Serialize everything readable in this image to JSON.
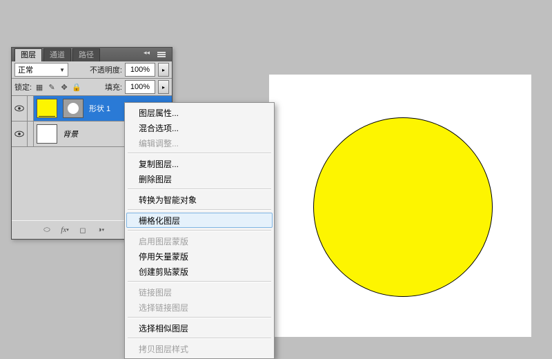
{
  "workspace": {
    "bg_color": "#bfbfbf"
  },
  "canvas": {
    "bg_color": "#ffffff",
    "shape": {
      "kind": "circle",
      "fill": "#fdf500",
      "stroke": "#000000"
    }
  },
  "panel": {
    "tabs": [
      {
        "id": "layers",
        "label": "图层",
        "active": true
      },
      {
        "id": "channels",
        "label": "通道",
        "active": false
      },
      {
        "id": "paths",
        "label": "路径",
        "active": false
      }
    ],
    "blend_mode": {
      "value": "正常"
    },
    "opacity": {
      "label": "不透明度:",
      "value": "100%"
    },
    "lock": {
      "label": "锁定:"
    },
    "fill": {
      "label": "填充:",
      "value": "100%"
    },
    "layers": [
      {
        "id": "shape1",
        "name": "形状 1",
        "visible": true,
        "selected": true,
        "thumb_color": "#fdf500",
        "has_mask": true
      },
      {
        "id": "bg",
        "name": "背景",
        "visible": true,
        "selected": false,
        "thumb_color": "#ffffff",
        "has_mask": false,
        "locked": true
      }
    ],
    "footer_icons": [
      "link",
      "fx",
      "mask",
      "adjust"
    ]
  },
  "context_menu": {
    "items": [
      {
        "label": "图层属性...",
        "enabled": true
      },
      {
        "label": "混合选项...",
        "enabled": true
      },
      {
        "label": "编辑调整...",
        "enabled": false
      },
      {
        "sep": true
      },
      {
        "label": "复制图层...",
        "enabled": true
      },
      {
        "label": "删除图层",
        "enabled": true
      },
      {
        "sep": true
      },
      {
        "label": "转换为智能对象",
        "enabled": true
      },
      {
        "sep": true
      },
      {
        "label": "栅格化图层",
        "enabled": true,
        "hover": true
      },
      {
        "sep": true
      },
      {
        "label": "启用图层蒙版",
        "enabled": false
      },
      {
        "label": "停用矢量蒙版",
        "enabled": true
      },
      {
        "label": "创建剪贴蒙版",
        "enabled": true
      },
      {
        "sep": true
      },
      {
        "label": "链接图层",
        "enabled": false
      },
      {
        "label": "选择链接图层",
        "enabled": false
      },
      {
        "sep": true
      },
      {
        "label": "选择相似图层",
        "enabled": true
      },
      {
        "sep": true
      },
      {
        "label": "拷贝图层样式",
        "enabled": false
      }
    ]
  }
}
